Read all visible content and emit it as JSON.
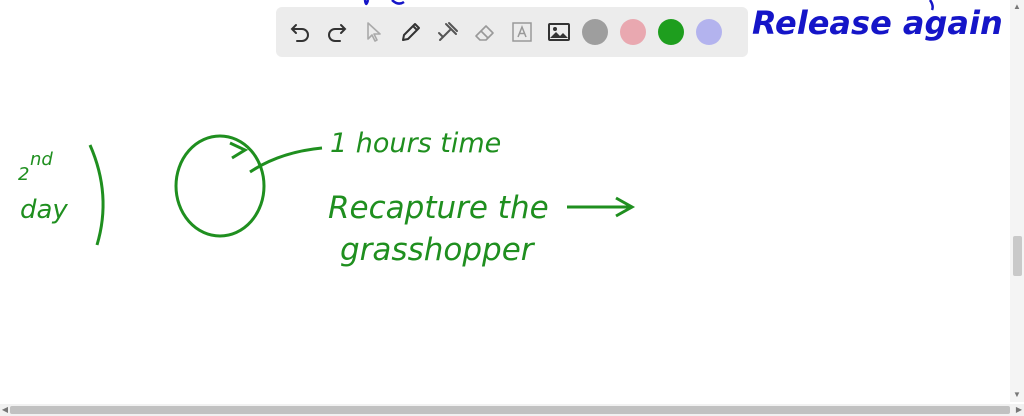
{
  "toolbar": {
    "tools": [
      {
        "name": "undo-icon"
      },
      {
        "name": "redo-icon"
      },
      {
        "name": "pointer-icon"
      },
      {
        "name": "pen-icon"
      },
      {
        "name": "tools-icon"
      },
      {
        "name": "eraser-icon"
      },
      {
        "name": "text-icon"
      },
      {
        "name": "image-icon"
      }
    ],
    "colors": [
      "#9e9e9e",
      "#e9a8b0",
      "#1e9e1e",
      "#b3b3ee"
    ]
  },
  "notes": {
    "blue_top": "Release again",
    "label_day": "2nd day",
    "label_time": "1 hours time",
    "line1": "Recapture the",
    "line2": "grasshopper"
  },
  "ink_colors": {
    "green": "#1f8f1f",
    "blue": "#1515c8"
  }
}
